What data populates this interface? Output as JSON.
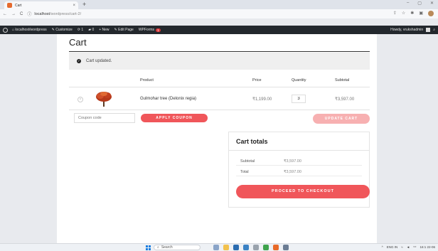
{
  "browser": {
    "tab_title": "Cart",
    "tab_close": "×",
    "new_tab": "+",
    "win_controls": [
      "–",
      "▢",
      "✕"
    ],
    "nav_back": "←",
    "nav_forward": "→",
    "nav_reload": "C",
    "url_host": "localhost",
    "url_path": "/wordpress/cart-2/"
  },
  "adminbar": {
    "site": "localhost/wordpress",
    "customize": "Customize",
    "updates": "1",
    "comments": "0",
    "new": "New",
    "edit_page": "Edit Page",
    "wpforms": "WPForms",
    "wpforms_badge": "1",
    "howdy": "Howdy, vrukshadmin"
  },
  "page": {
    "title": "Cart",
    "notice": "Cart updated.",
    "headers": {
      "product": "Product",
      "price": "Price",
      "quantity": "Quantity",
      "subtotal": "Subtotal"
    },
    "item": {
      "name": "Gulmohar tree (Delonix regia)",
      "price": "₹1,199.00",
      "quantity": "3",
      "subtotal": "₹3,597.00"
    },
    "coupon_placeholder": "Coupon code",
    "apply_coupon": "APPLY COUPON",
    "update_cart": "UPDATE CART"
  },
  "totals": {
    "title": "Cart totals",
    "subtotal_label": "Subtotal",
    "subtotal_value": "₹3,597.00",
    "total_label": "Total",
    "total_value": "₹3,597.00",
    "checkout": "PROCEED TO CHECKOUT"
  },
  "taskbar": {
    "search": "Search",
    "lang": "ENG",
    "region": "IN",
    "time": "16:1",
    "date": "22-06"
  },
  "colors": {
    "accent": "#f0565a",
    "accent_disabled": "#f7b0b1",
    "adminbar": "#23282d"
  }
}
